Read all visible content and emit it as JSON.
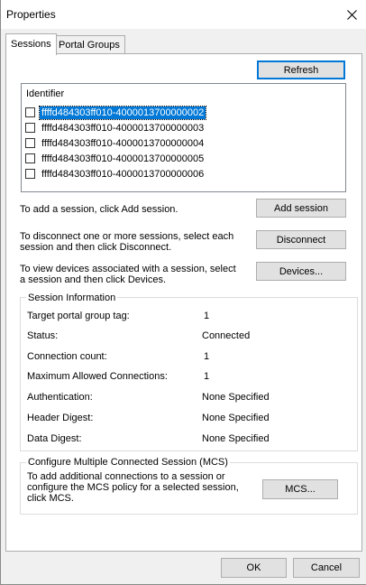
{
  "window": {
    "title": "Properties"
  },
  "tabs": [
    {
      "label": "Sessions"
    },
    {
      "label": "Portal Groups"
    }
  ],
  "buttons": {
    "refresh": "Refresh",
    "add_session": "Add session",
    "disconnect": "Disconnect",
    "devices": "Devices...",
    "mcs": "MCS...",
    "ok": "OK",
    "cancel": "Cancel"
  },
  "sessions_list": {
    "header": "Identifier",
    "items": [
      {
        "id": "ffffd484303ff010-4000013700000002",
        "checked": false,
        "selected": true
      },
      {
        "id": "ffffd484303ff010-4000013700000003",
        "checked": false,
        "selected": false
      },
      {
        "id": "ffffd484303ff010-4000013700000004",
        "checked": false,
        "selected": false
      },
      {
        "id": "ffffd484303ff010-4000013700000005",
        "checked": false,
        "selected": false
      },
      {
        "id": "ffffd484303ff010-4000013700000006",
        "checked": false,
        "selected": false
      }
    ]
  },
  "instructions": {
    "add": "To add a session, click Add session.",
    "disconnect_line1": "To disconnect one or more sessions, select each",
    "disconnect_line2": "session and then click Disconnect.",
    "devices_line1": "To view devices associated with a session, select",
    "devices_line2": "a session and then click Devices."
  },
  "session_info": {
    "legend": "Session Information",
    "fields": [
      {
        "label": "Target portal group tag:",
        "value": "1"
      },
      {
        "label": "Status:",
        "value": "Connected"
      },
      {
        "label": "Connection count:",
        "value": "1"
      },
      {
        "label": "Maximum Allowed Connections:",
        "value": "1"
      },
      {
        "label": "Authentication:",
        "value": "None Specified"
      },
      {
        "label": "Header Digest:",
        "value": "None Specified"
      },
      {
        "label": "Data Digest:",
        "value": "None Specified"
      }
    ]
  },
  "mcs_group": {
    "legend": "Configure Multiple Connected Session (MCS)",
    "line1": "To add additional connections to a session or",
    "line2": "configure the MCS policy for a selected session,",
    "line3": "click MCS."
  },
  "icons": {
    "close": "close-icon",
    "checkbox": "checkbox-unchecked"
  }
}
